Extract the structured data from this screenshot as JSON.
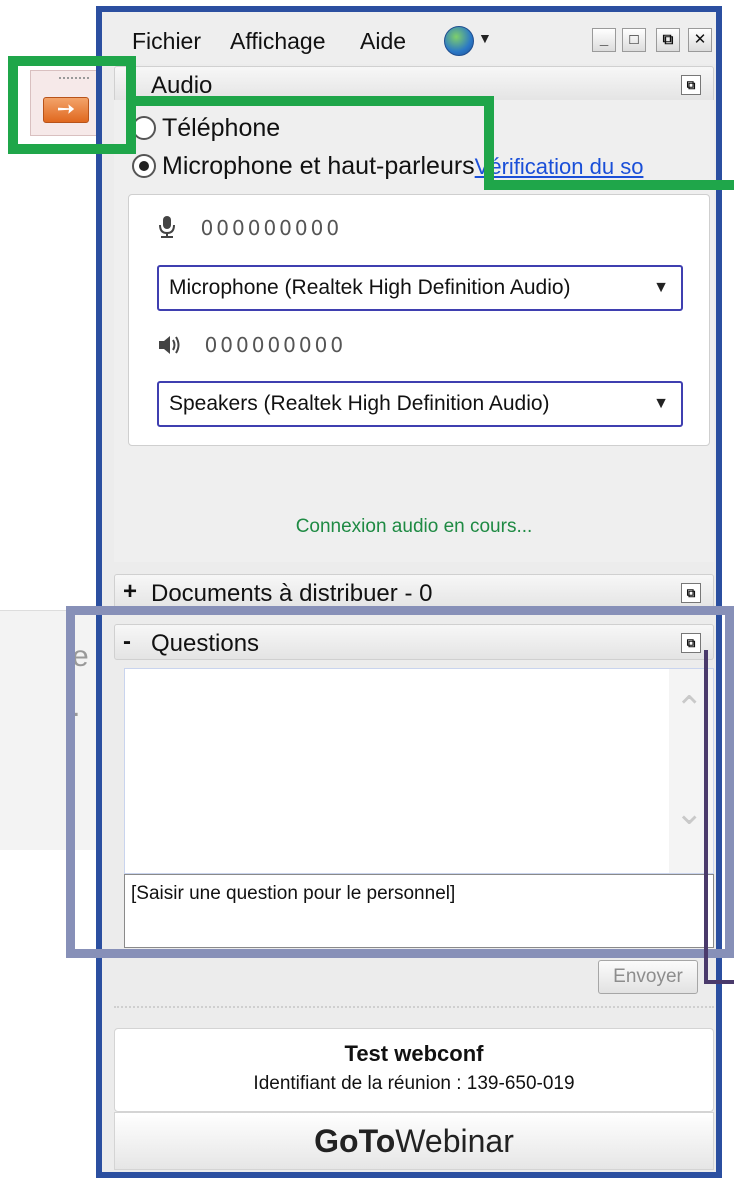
{
  "menu": {
    "file": "Fichier",
    "view": "Affichage",
    "help": "Aide"
  },
  "window_buttons": {
    "minimize": "_",
    "maximize": "□",
    "restore": "⧉",
    "close": "✕"
  },
  "audio": {
    "title": "Audio",
    "option_phone": "Téléphone",
    "option_mic": "Microphone et haut-parleurs",
    "check_link": "Vérification du so",
    "mic_level": "000000000",
    "mic_device": "Microphone (Realtek High Definition Audio)",
    "speaker_level": "000000000",
    "speaker_device": "Speakers (Realtek High Definition Audio)",
    "status": "Connexion audio en cours..."
  },
  "handouts": {
    "title": "Documents à distribuer - 0",
    "toggle": "+"
  },
  "questions": {
    "title": "Questions",
    "toggle": "-",
    "input_value": "[Saisir une question pour le personnel]",
    "send_label": "Envoyer"
  },
  "meeting": {
    "title": "Test webconf",
    "id_line": "Identifiant de la réunion : 139-650-019"
  },
  "brand": {
    "bold": "GoTo",
    "light": "Webinar"
  },
  "background": {
    "fragment1": "e",
    "fragment2": "."
  },
  "colors": {
    "panel_border": "#2b4fa0",
    "annotation_green": "#1fa64a",
    "annotation_gray": "#8790b8",
    "status_green": "#1e8a43",
    "link_blue": "#1a4fd8"
  }
}
